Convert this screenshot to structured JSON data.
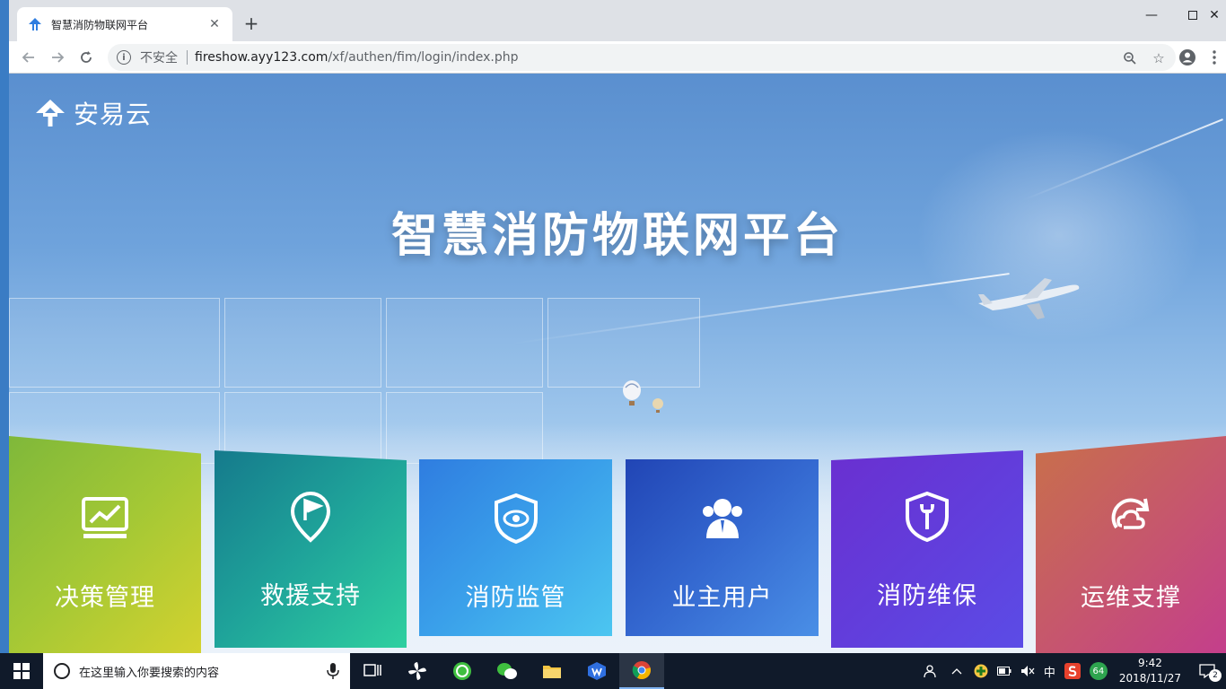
{
  "browser": {
    "tab_title": "智慧消防物联网平台",
    "new_tab_label": "+",
    "security_label": "不安全",
    "url_host": "fireshow.ayy123.com",
    "url_path": "/xf/authen/fim/login/index.php"
  },
  "page": {
    "logo_text": "安易云",
    "title": "智慧消防物联网平台",
    "cards": [
      {
        "label": "决策管理",
        "icon": "chart-monitor-icon"
      },
      {
        "label": "救援支持",
        "icon": "flag-pin-icon"
      },
      {
        "label": "消防监管",
        "icon": "shield-eye-icon"
      },
      {
        "label": "业主用户",
        "icon": "users-icon"
      },
      {
        "label": "消防维保",
        "icon": "shield-wrench-icon"
      },
      {
        "label": "运维支撑",
        "icon": "cloud-refresh-icon"
      }
    ]
  },
  "taskbar": {
    "search_placeholder": "在这里输入你要搜索的内容",
    "ime_label": "中",
    "badge_count": "64",
    "time": "9:42",
    "date": "2018/11/27",
    "notification_count": "2"
  },
  "colors": {
    "card_1": [
      "#7fb83a",
      "#d4d22f"
    ],
    "card_2": [
      "#157a8c",
      "#2fd0a0"
    ],
    "card_3": [
      "#2f7de0",
      "#4cc6f0"
    ],
    "card_4": [
      "#2145b5",
      "#4a8fe6"
    ],
    "card_5": [
      "#6a2fd0",
      "#5b4ce6"
    ],
    "card_6": [
      "#c8704a",
      "#c43e8c"
    ]
  }
}
